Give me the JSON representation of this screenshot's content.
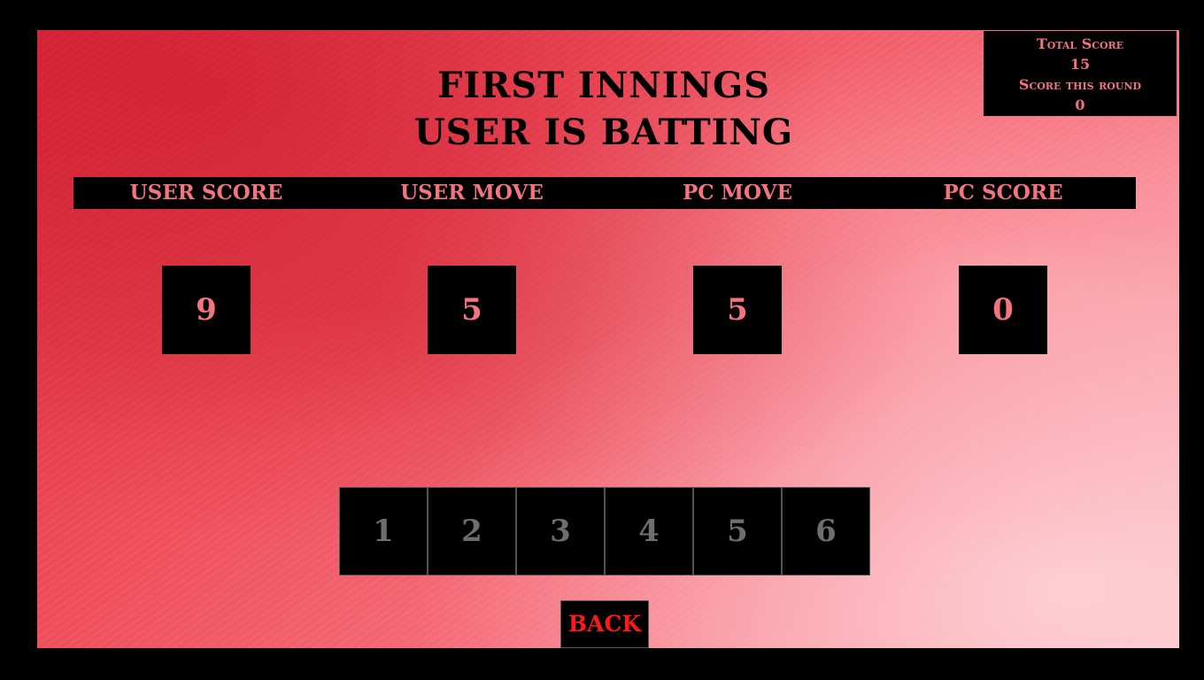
{
  "title": {
    "line1": "FIRST INNINGS",
    "line2": "USER IS BATTING"
  },
  "score_panel": {
    "total_score_label": "Total Score",
    "total_score": "15",
    "round_score_label": "Score this round",
    "round_score": "0"
  },
  "headers": {
    "user_score": "USER SCORE",
    "user_move": "USER MOVE",
    "pc_move": "PC MOVE",
    "pc_score": "PC SCORE"
  },
  "values": {
    "user_score": "9",
    "user_move": "5",
    "pc_move": "5",
    "pc_score": "0"
  },
  "moves": [
    "1",
    "2",
    "3",
    "4",
    "5",
    "6"
  ],
  "back_label": "BACK",
  "colors": {
    "accent": "#f3737f",
    "back_text": "#ff1a1a",
    "move_text": "#6e6e6e",
    "panel": "#000000"
  }
}
